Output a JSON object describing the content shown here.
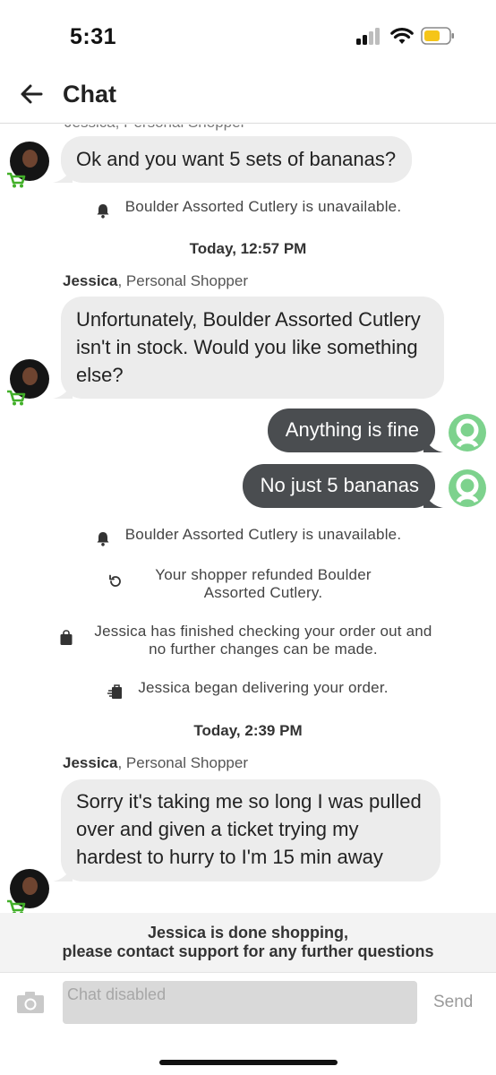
{
  "status_bar": {
    "time": "5:31",
    "battery_color": "#f5c518"
  },
  "header": {
    "back_icon": "back-arrow-icon",
    "title": "Chat"
  },
  "messages": {
    "clipped_sender": "Jessica, Personal Shopper",
    "bubble_1": "Ok and you want 5 sets of bananas?",
    "system_1": "Boulder Assorted Cutlery is unavailable.",
    "timestamp_1": "Today, 12:57 PM",
    "sender_name": "Jessica",
    "sender_role": ", Personal Shopper",
    "bubble_2": "Unfortunately, Boulder Assorted Cutlery isn't in stock. Would you like something else?",
    "user_bubble_1": "Anything is fine",
    "user_bubble_2": "No just 5 bananas",
    "system_2": "Boulder Assorted Cutlery is unavailable.",
    "system_3": "Your shopper refunded Boulder Assorted Cutlery.",
    "system_4": "Jessica has finished checking your order out and no further changes can be made.",
    "system_5": "Jessica began delivering your order.",
    "timestamp_2": "Today, 2:39 PM",
    "bubble_3": "Sorry it's taking me so long I was pulled over and given a ticket trying my hardest to hurry to I'm 15 min away"
  },
  "notice": {
    "line_1": "Jessica is done shopping,",
    "line_2": "please contact support for any further questions"
  },
  "composer": {
    "placeholder": "Chat disabled",
    "send_label": "Send"
  },
  "colors": {
    "incoming_bubble": "#ececec",
    "outgoing_bubble": "#4a4d50",
    "user_avatar": "#7dd28d",
    "cart_badge": "#43b02a"
  }
}
